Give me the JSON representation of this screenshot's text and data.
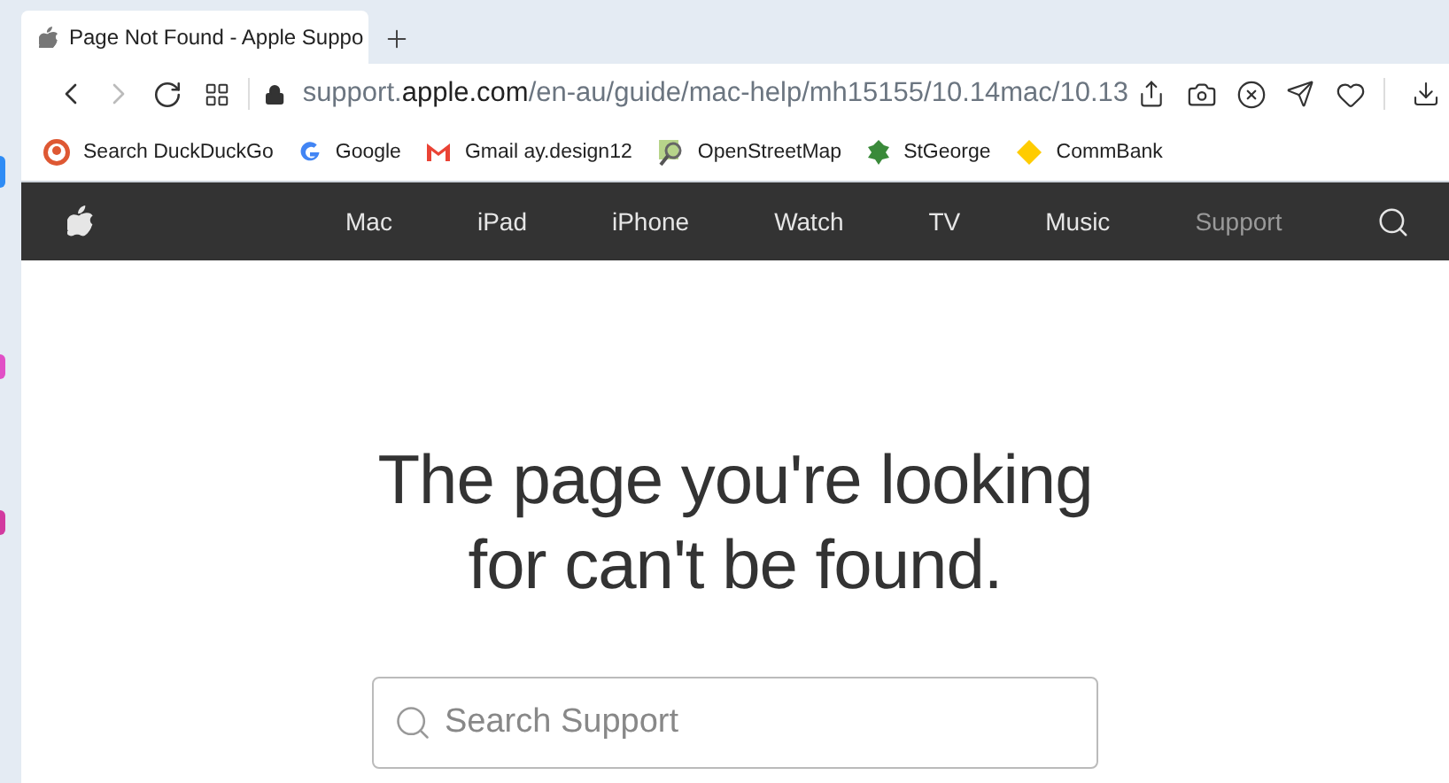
{
  "tab": {
    "title": "Page Not Found - Apple Suppo"
  },
  "address": {
    "host_prefix": "support.",
    "domain": "apple.com",
    "path": "/en-au/guide/mac-help/mh15155/10.14mac/10.13"
  },
  "bookmarks": [
    {
      "kind": "duck",
      "label": "Search DuckDuckGo"
    },
    {
      "kind": "google",
      "label": "Google"
    },
    {
      "kind": "gmail",
      "label": "Gmail ay.design12"
    },
    {
      "kind": "map",
      "label": "OpenStreetMap"
    },
    {
      "kind": "dragon",
      "label": "StGeorge"
    },
    {
      "kind": "diamond",
      "label": "CommBank"
    }
  ],
  "nav": [
    {
      "label": "Mac",
      "selected": false
    },
    {
      "label": "iPad",
      "selected": false
    },
    {
      "label": "iPhone",
      "selected": false
    },
    {
      "label": "Watch",
      "selected": false
    },
    {
      "label": "TV",
      "selected": false
    },
    {
      "label": "Music",
      "selected": false
    },
    {
      "label": "Support",
      "selected": true
    }
  ],
  "heading": "The page you're looking for can't be found.",
  "search": {
    "placeholder": "Search Support"
  }
}
